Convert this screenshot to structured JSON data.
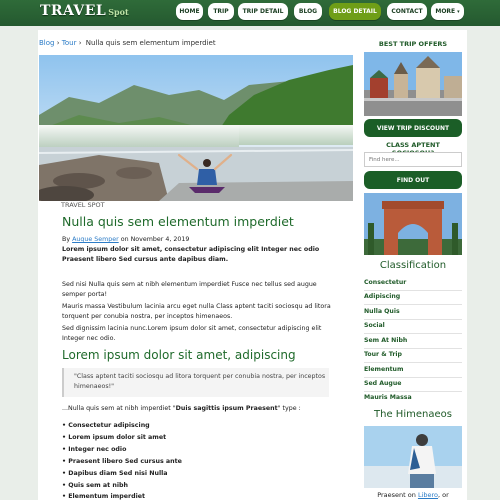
{
  "site": {
    "logo_main": "TRAVEL",
    "logo_sub": "Spot",
    "nav": [
      {
        "label": "HOME",
        "active": false
      },
      {
        "label": "TRIP",
        "active": false
      },
      {
        "label": "TRIP DETAIL",
        "active": false
      },
      {
        "label": "BLOG",
        "active": false
      },
      {
        "label": "BLOG DETAIL",
        "active": true
      },
      {
        "label": "CONTACT",
        "active": false
      },
      {
        "label": "MORE",
        "active": false
      }
    ],
    "nav_caret": "▾"
  },
  "breadcrumb": {
    "items": [
      "Blog",
      "Tour"
    ],
    "separator": "›",
    "current": "Nulla quis sem elementum imperdiet"
  },
  "post": {
    "category": "TRAVEL SPOT",
    "title": "Nulla quis sem elementum imperdiet",
    "by_prefix": "By",
    "author": "Augue Semper",
    "date_prefix": "on",
    "date": "November 4, 2019",
    "lead": "Lorem ipsum dolor sit amet, consectetur adipiscing elit Integer nec odio Praesent libero Sed cursus ante dapibus diam.",
    "p1": "Sed nisi Nulla quis sem at nibh elementum imperdiet Fusce nec tellus sed augue semper porta!",
    "p2": "Mauris massa Vestibulum lacinia arcu eget nulla Class aptent taciti sociosqu ad litora torquent per conubia nostra, per inceptos himenaeos.",
    "p3": "Sed dignissim lacinia nunc.Lorem ipsum dolor sit amet, consectetur adipiscing elit Integer nec odio.",
    "h2": "Lorem ipsum dolor sit amet, adipiscing",
    "quote": "\"Class aptent taciti sociosqu ad litora torquent per conubia nostra, per inceptos himenaeos!\"",
    "list_intro_pre": "...Nulla quis sem at nibh imperdiet \"",
    "list_intro_bold": "Duis sagittis ipsum Praesent",
    "list_intro_post": "\" type :",
    "bullets": [
      "Consectetur adipiscing",
      "Lorem ipsum dolor sit amet",
      "Integer nec odio",
      "Praesent libero Sed cursus ante",
      "Dapibus diam Sed nisi Nulla",
      "Quis sem at nibh",
      "Elementum imperdiet"
    ]
  },
  "sidebar": {
    "best_offers_title": "BEST TRIP OFFERS",
    "view_discount_label": "VIEW TRIP DISCOUNT",
    "search_title": "CLASS APTENT SOCIOSQU?",
    "search_placeholder": "Find here...",
    "find_label": "FIND OUT",
    "classification_title": "Classification",
    "categories": [
      "Consectetur",
      "Adipiscing",
      "Nulla Quis",
      "Social",
      "Sem At Nibh",
      "Tour & Trip",
      "Elementum",
      "Sed Augue",
      "Mauris Massa"
    ],
    "himenaeos_title": "The Himenaeos",
    "footer_pre": "Praesent on",
    "footer_link": "Libero",
    "footer_post": ", or"
  }
}
